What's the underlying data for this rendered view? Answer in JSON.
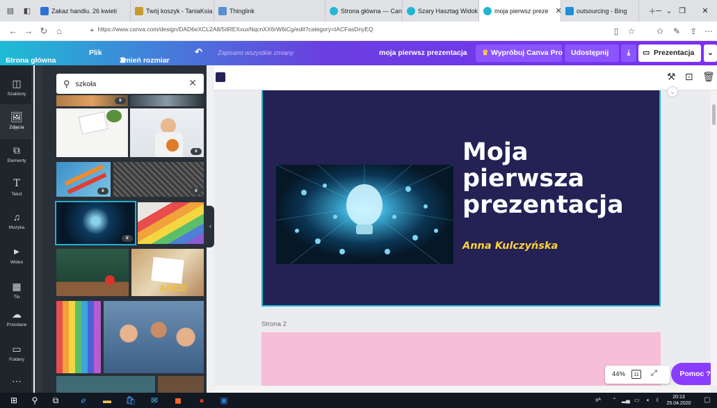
{
  "browser": {
    "tabs": [
      {
        "label": "Zakaz handlu. 26 kwieti",
        "fav": "#2e6fd6",
        "active": false
      },
      {
        "label": "Twój koszyk - TaniaKsia",
        "fav": "#c79b2b",
        "active": false
      },
      {
        "label": "Thinglink",
        "fav": "#5a8fd0",
        "active": false
      },
      {
        "label": "Strona główna — Canv",
        "fav": "#23b6d3",
        "active": false
      },
      {
        "label": "Szary Hasztag Widok z",
        "fav": "#23b6d3",
        "active": false
      },
      {
        "label": "moja pierwsz preze",
        "fav": "#23b6d3",
        "active": true
      },
      {
        "label": "outsourcing - Bing",
        "fav": "#1f8fd8",
        "active": false
      }
    ],
    "url": "https://www.canva.com/design/DAD6eXCL2A8/5iIREXxuxNqcnXX6rW6iCg/edit?category=tACFasDnyEQ"
  },
  "header": {
    "home": "Strona główna",
    "file": "Plik",
    "resize": "Zmień rozmiar",
    "saved": "Zapisano wszystkie zmiany",
    "doc_title": "moja pierwsz prezentacja",
    "try_pro": "Wypróbuj Canva Pro",
    "share": "Udostępnij",
    "present": "Prezentacja"
  },
  "rail": [
    {
      "label": "Szablony",
      "icon": "templates-icon",
      "glyph": "◫",
      "active": false
    },
    {
      "label": "Zdjęcia",
      "icon": "photos-icon",
      "glyph": "🖼",
      "active": true
    },
    {
      "label": "Elementy",
      "icon": "elements-icon",
      "glyph": "⧉",
      "active": false
    },
    {
      "label": "Tekst",
      "icon": "text-icon",
      "glyph": "T",
      "active": false
    },
    {
      "label": "Muzyka",
      "icon": "music-icon",
      "glyph": "♫",
      "active": false
    },
    {
      "label": "Wideo",
      "icon": "video-icon",
      "glyph": "▶",
      "active": false
    },
    {
      "label": "Tło",
      "icon": "background-icon",
      "glyph": "▦",
      "active": false
    },
    {
      "label": "Przesłane",
      "icon": "upload-icon",
      "glyph": "☁",
      "active": false
    },
    {
      "label": "Foldery",
      "icon": "folder-icon",
      "glyph": "▭",
      "active": false
    },
    {
      "label": "Więcej",
      "icon": "more-icon",
      "glyph": "⋯",
      "active": false
    }
  ],
  "search": {
    "value": "szkoła"
  },
  "slide1": {
    "title_lines": [
      "Moja",
      "pierwsza",
      "prezentacja"
    ],
    "author": "Anna Kulczyńska"
  },
  "page2_label": "Strona 2",
  "zoom": {
    "level": "44%",
    "page_count": "11"
  },
  "help": "Pomoc ?",
  "clock": {
    "time": "20:13",
    "date": "25.04.2020"
  },
  "colors": {
    "canva_accent": "#7d2ae8",
    "slide_bg": "#242155",
    "slide_border": "#20b8d2",
    "author": "#ffd335",
    "slide2_bg": "#f7bed8"
  }
}
